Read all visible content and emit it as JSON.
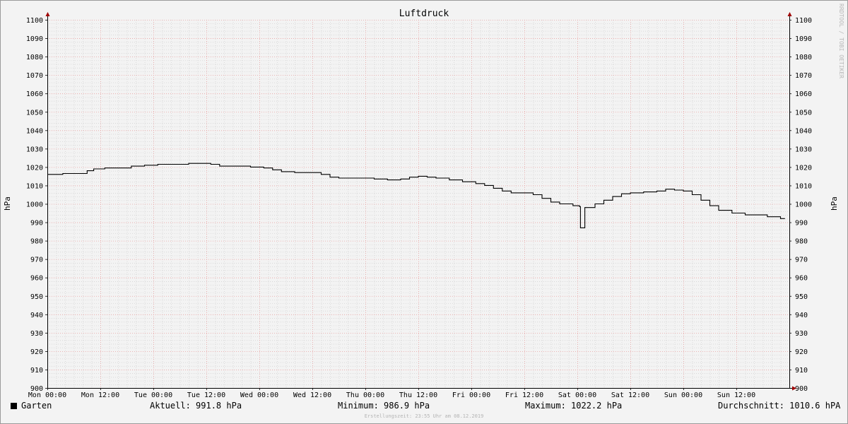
{
  "chart_data": {
    "type": "line",
    "title": "Luftdruck",
    "ylabel_left": "hPa",
    "ylabel_right": "hPa",
    "watermark": "RRDTOOL / TOBI OETIKER",
    "ylim": [
      900,
      1100
    ],
    "y_ticks": [
      900,
      910,
      920,
      930,
      940,
      950,
      960,
      970,
      980,
      990,
      1000,
      1010,
      1020,
      1030,
      1040,
      1050,
      1060,
      1070,
      1080,
      1090,
      1100
    ],
    "xlim_hours": [
      0,
      168
    ],
    "x_ticks": [
      {
        "h": 0,
        "label": "Mon 00:00"
      },
      {
        "h": 12,
        "label": "Mon 12:00"
      },
      {
        "h": 24,
        "label": "Tue 00:00"
      },
      {
        "h": 36,
        "label": "Tue 12:00"
      },
      {
        "h": 48,
        "label": "Wed 00:00"
      },
      {
        "h": 60,
        "label": "Wed 12:00"
      },
      {
        "h": 72,
        "label": "Thu 00:00"
      },
      {
        "h": 84,
        "label": "Thu 12:00"
      },
      {
        "h": 96,
        "label": "Fri 00:00"
      },
      {
        "h": 108,
        "label": "Fri 12:00"
      },
      {
        "h": 120,
        "label": "Sat 00:00"
      },
      {
        "h": 132,
        "label": "Sat 12:00"
      },
      {
        "h": 144,
        "label": "Sun 00:00"
      },
      {
        "h": 156,
        "label": "Sun 12:00"
      }
    ],
    "series": [
      {
        "name": "Garten",
        "color": "#000000",
        "points": [
          [
            0,
            1016
          ],
          [
            3,
            1016
          ],
          [
            3.5,
            1016.5
          ],
          [
            6,
            1016.5
          ],
          [
            9,
            1018
          ],
          [
            10.5,
            1019
          ],
          [
            13,
            1019.5
          ],
          [
            17,
            1019.5
          ],
          [
            19,
            1020.5
          ],
          [
            22,
            1021
          ],
          [
            25,
            1021.5
          ],
          [
            29,
            1021.5
          ],
          [
            32,
            1022
          ],
          [
            35,
            1022
          ],
          [
            37,
            1021.5
          ],
          [
            39,
            1020.5
          ],
          [
            43,
            1020.5
          ],
          [
            46,
            1020
          ],
          [
            49,
            1019.5
          ],
          [
            51,
            1018.5
          ],
          [
            53,
            1017.5
          ],
          [
            56,
            1017
          ],
          [
            60,
            1017
          ],
          [
            62,
            1016
          ],
          [
            64,
            1014.5
          ],
          [
            66,
            1014
          ],
          [
            71,
            1014
          ],
          [
            74,
            1013.5
          ],
          [
            77,
            1013
          ],
          [
            80,
            1013.5
          ],
          [
            81,
            1013.5
          ],
          [
            82,
            1014.5
          ],
          [
            84,
            1015
          ],
          [
            86,
            1014.5
          ],
          [
            88,
            1014
          ],
          [
            91,
            1013
          ],
          [
            94,
            1012
          ],
          [
            97,
            1011
          ],
          [
            99,
            1010
          ],
          [
            101,
            1008.5
          ],
          [
            103,
            1007
          ],
          [
            105,
            1006
          ],
          [
            108,
            1006
          ],
          [
            110,
            1005
          ],
          [
            112,
            1003
          ],
          [
            114,
            1001
          ],
          [
            116,
            1000
          ],
          [
            119,
            999
          ],
          [
            120.5,
            998.5
          ],
          [
            120.7,
            987
          ],
          [
            121.5,
            987
          ],
          [
            121.7,
            998
          ],
          [
            124,
            1000
          ],
          [
            126,
            1002
          ],
          [
            128,
            1004
          ],
          [
            130,
            1005.5
          ],
          [
            132,
            1006
          ],
          [
            135,
            1006.5
          ],
          [
            138,
            1007
          ],
          [
            140,
            1008
          ],
          [
            142,
            1007.5
          ],
          [
            144,
            1007
          ],
          [
            146,
            1005
          ],
          [
            148,
            1002
          ],
          [
            150,
            999
          ],
          [
            152,
            996.5
          ],
          [
            155,
            995
          ],
          [
            158,
            994
          ],
          [
            163,
            993
          ],
          [
            166,
            992
          ],
          [
            167,
            992
          ]
        ]
      }
    ],
    "stats": {
      "aktuell": "Aktuell: 991.8 hPa",
      "minimum": "Minimum: 986.9 hPa",
      "maximum": "Maximum: 1022.2 hPa",
      "durchschnitt": "Durchschnitt: 1010.6 hPA"
    },
    "footer": "Erstellungszeit: 23:55 Uhr am 08.12.2019"
  }
}
